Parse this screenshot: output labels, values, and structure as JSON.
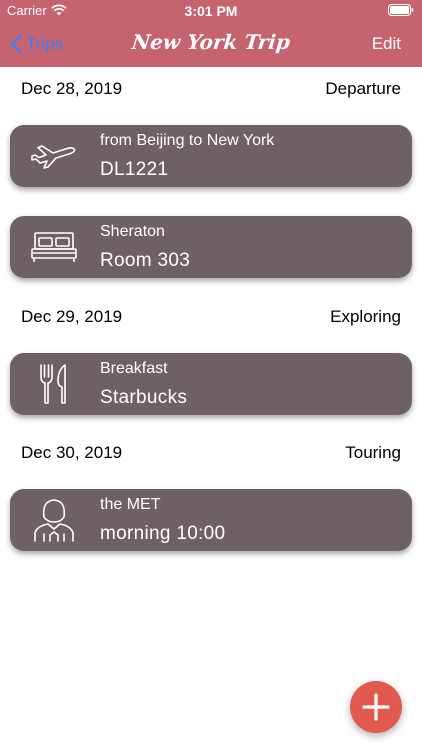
{
  "status_bar": {
    "carrier": "Carrier",
    "time": "3:01 PM"
  },
  "nav": {
    "back_label": "Trips",
    "title": "New York Trip",
    "edit_label": "Edit"
  },
  "sections": [
    {
      "date": "Dec 28, 2019",
      "tag": "Departure",
      "items": [
        {
          "icon": "airplane-icon",
          "title": "from Beijing to New York",
          "subtitle": "DL1221"
        },
        {
          "icon": "bed-icon",
          "title": "Sheraton",
          "subtitle": "Room 303"
        }
      ]
    },
    {
      "date": "Dec 29, 2019",
      "tag": "Exploring",
      "items": [
        {
          "icon": "fork-knife-icon",
          "title": "Breakfast",
          "subtitle": "Starbucks"
        }
      ]
    },
    {
      "date": "Dec 30, 2019",
      "tag": "Touring",
      "items": [
        {
          "icon": "person-icon",
          "title": "the MET",
          "subtitle": "morning 10:00"
        }
      ]
    }
  ],
  "fab": {
    "icon": "plus-icon"
  },
  "colors": {
    "header": "#c5636f",
    "card": "#6d6163",
    "accent": "#3c7ff7",
    "fab": "#e25a4f"
  }
}
